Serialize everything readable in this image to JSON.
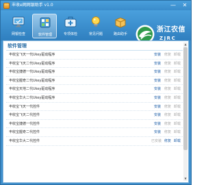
{
  "window": {
    "title": "丰收e网网银助手 v1.0",
    "minimize_glyph": "—",
    "close_glyph": "✕"
  },
  "toolbar": {
    "items": [
      {
        "label": "网银检查",
        "icon": "monitor-check-icon"
      },
      {
        "label": "软件管理",
        "icon": "software-manager-icon",
        "selected": true
      },
      {
        "label": "专项体检",
        "icon": "medical-kit-icon"
      },
      {
        "label": "常见问题",
        "icon": "lightbulb-icon"
      },
      {
        "label": "路由助手",
        "icon": "router-box-icon"
      }
    ]
  },
  "logo": {
    "name_cn": "浙江农信",
    "name_en": "ZJRC"
  },
  "section": {
    "title": "软件管理"
  },
  "software_list": [
    {
      "name": "丰收宝飞天一代Ukey驱动程序",
      "actions": [
        "安装",
        "修复",
        "卸载"
      ],
      "enabled": [
        true,
        false,
        false
      ]
    },
    {
      "name": "丰收宝飞天二代Ukey驱动程序",
      "actions": [
        "安装",
        "修复",
        "卸载"
      ],
      "enabled": [
        true,
        false,
        false
      ]
    },
    {
      "name": "丰收宝捷德一代Ukey驱动程序",
      "actions": [
        "安装",
        "修复",
        "卸载"
      ],
      "enabled": [
        true,
        false,
        false
      ]
    },
    {
      "name": "丰收宝握奇二代Ukey驱动程序",
      "actions": [
        "安装",
        "修复",
        "卸载"
      ],
      "enabled": [
        true,
        false,
        false
      ]
    },
    {
      "name": "丰收宝天地二代Ukey驱动程序",
      "actions": [
        "安装",
        "修复",
        "卸载"
      ],
      "enabled": [
        true,
        false,
        false
      ]
    },
    {
      "name": "丰收宝华大二代Ukey驱动程序",
      "actions": [
        "安装",
        "修复",
        "卸载"
      ],
      "enabled": [
        true,
        false,
        false
      ]
    },
    {
      "name": "丰收宝飞天一代控件",
      "actions": [
        "安装",
        "修复",
        "卸载"
      ],
      "enabled": [
        true,
        false,
        false
      ]
    },
    {
      "name": "丰收宝飞天二代控件",
      "actions": [
        "安装",
        "修复",
        "卸载"
      ],
      "enabled": [
        true,
        false,
        false
      ]
    },
    {
      "name": "丰收宝捷德一代控件",
      "actions": [
        "安装",
        "修复",
        "卸载"
      ],
      "enabled": [
        true,
        false,
        false
      ]
    },
    {
      "name": "丰收宝握奇二代控件",
      "actions": [
        "安装",
        "修复",
        "卸载"
      ],
      "enabled": [
        true,
        false,
        false
      ]
    },
    {
      "name": "丰收宝华大二代控件",
      "status": "已安装",
      "actions": [
        "修复",
        "卸载"
      ],
      "enabled": [
        true,
        true
      ]
    }
  ]
}
